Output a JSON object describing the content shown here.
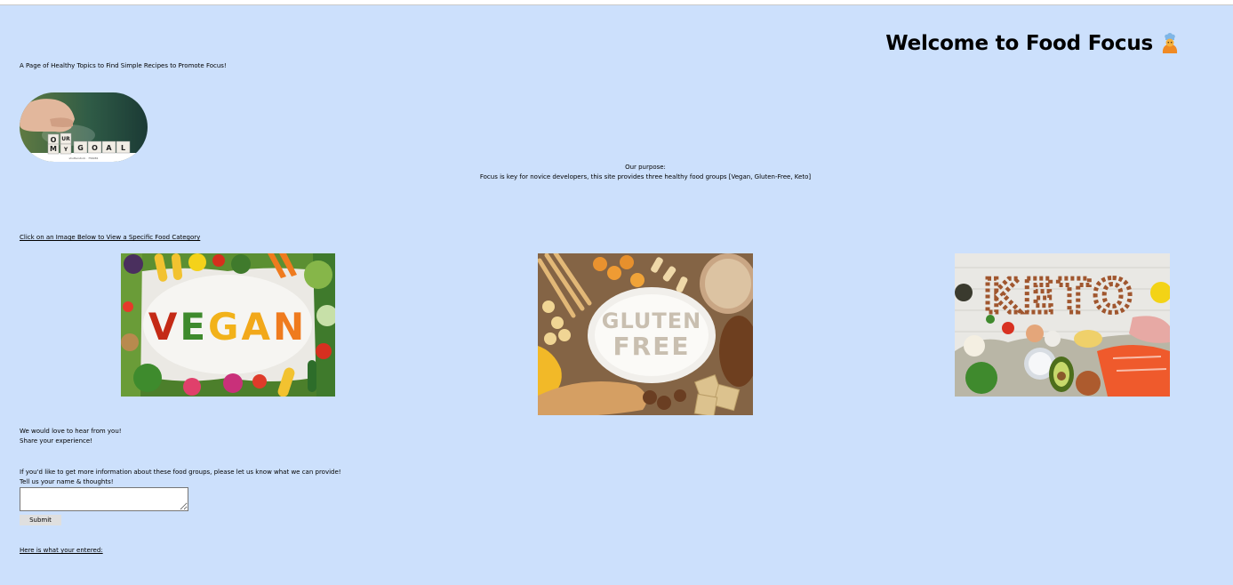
{
  "header": {
    "title": "Welcome to Food Focus",
    "title_icon": "cook-emoji-icon",
    "tagline": "A Page of Healthy Topics to Find Simple Recipes to Promote Focus!"
  },
  "logo": {
    "image_text": "OUR MY GOAL",
    "tiles": [
      "O",
      "U",
      "R",
      "M",
      "Y",
      "G",
      "O",
      "A",
      "L"
    ]
  },
  "purpose": {
    "heading": "Our purpose:",
    "text": "Focus is key for novice developers, this site provides three healthy food groups [Vegan, Gluten-Free, Keto]"
  },
  "categories": {
    "link_text": "Click on an Image Below to View a Specific Food Category",
    "items": [
      {
        "name": "vegan",
        "word": "VEGAN"
      },
      {
        "name": "gluten-free",
        "word_line1": "GLUTEN",
        "word_line2": "FREE"
      },
      {
        "name": "keto",
        "word": "KETO"
      }
    ]
  },
  "feedback": {
    "line1": "We would love to hear from you!",
    "line2": "Share your experience!",
    "info_line": "If you'd like to get more information about these food groups, please let us know what we can provide!",
    "prompt": "Tell us your name & thoughts!",
    "input_value": "",
    "submit_label": "Submit",
    "entered_link": "Here is what your entered:"
  },
  "colors": {
    "page_background": "#cce0fc",
    "text": "#000000"
  }
}
